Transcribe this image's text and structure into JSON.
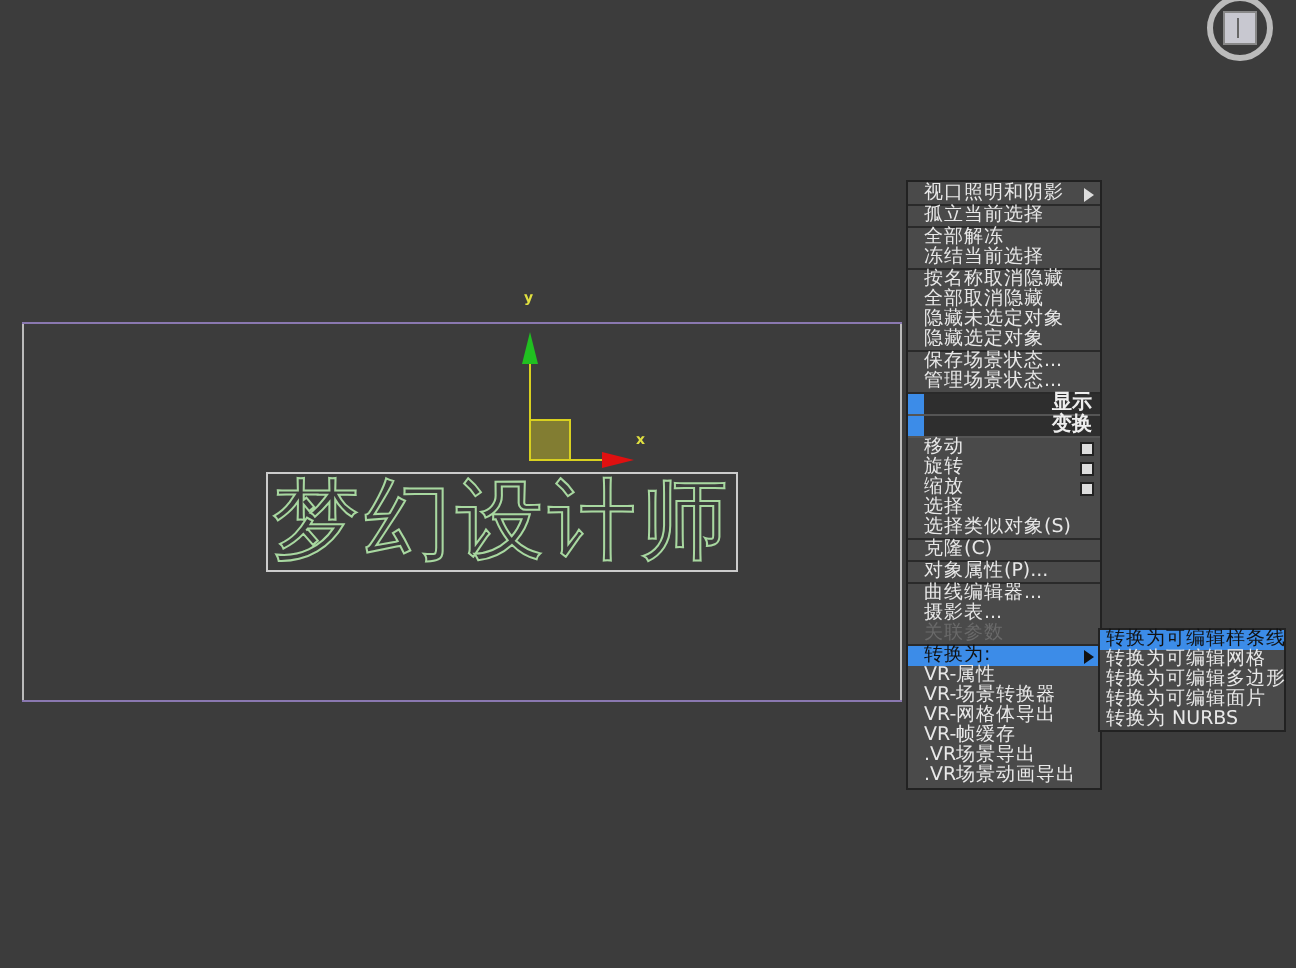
{
  "viewport": {
    "object_text": "梦幻设计师",
    "axis_y": "y",
    "axis_x": "x"
  },
  "menu": {
    "items": [
      {
        "kind": "submenu",
        "label": "视口照明和阴影",
        "selected": false,
        "disabled": false
      },
      {
        "kind": "separator"
      },
      {
        "kind": "item",
        "label": "孤立当前选择",
        "selected": false,
        "disabled": false
      },
      {
        "kind": "separator"
      },
      {
        "kind": "item",
        "label": "全部解冻",
        "selected": false,
        "disabled": false
      },
      {
        "kind": "item",
        "label": "冻结当前选择",
        "selected": false,
        "disabled": false
      },
      {
        "kind": "separator"
      },
      {
        "kind": "item",
        "label": "按名称取消隐藏",
        "selected": false,
        "disabled": false
      },
      {
        "kind": "item",
        "label": "全部取消隐藏",
        "selected": false,
        "disabled": false
      },
      {
        "kind": "item",
        "label": "隐藏未选定对象",
        "selected": false,
        "disabled": false
      },
      {
        "kind": "item",
        "label": "隐藏选定对象",
        "selected": false,
        "disabled": false
      },
      {
        "kind": "separator"
      },
      {
        "kind": "item",
        "label": "保存场景状态...",
        "selected": false,
        "disabled": false
      },
      {
        "kind": "item",
        "label": "管理场景状态...",
        "selected": false,
        "disabled": false
      },
      {
        "kind": "separator"
      },
      {
        "kind": "header",
        "label": "显示"
      },
      {
        "kind": "header",
        "label": "变换"
      },
      {
        "kind": "option",
        "label": "移动",
        "selected": false,
        "disabled": false
      },
      {
        "kind": "option",
        "label": "旋转",
        "selected": false,
        "disabled": false
      },
      {
        "kind": "option",
        "label": "缩放",
        "selected": false,
        "disabled": false
      },
      {
        "kind": "item",
        "label": "选择",
        "selected": false,
        "disabled": false
      },
      {
        "kind": "item",
        "label": "选择类似对象(S)",
        "selected": false,
        "disabled": false
      },
      {
        "kind": "separator"
      },
      {
        "kind": "item",
        "label": "克隆(C)",
        "selected": false,
        "disabled": false
      },
      {
        "kind": "separator"
      },
      {
        "kind": "item",
        "label": "对象属性(P)...",
        "selected": false,
        "disabled": false
      },
      {
        "kind": "separator"
      },
      {
        "kind": "item",
        "label": "曲线编辑器...",
        "selected": false,
        "disabled": false
      },
      {
        "kind": "item",
        "label": "摄影表...",
        "selected": false,
        "disabled": false
      },
      {
        "kind": "item",
        "label": "关联参数",
        "selected": false,
        "disabled": true
      },
      {
        "kind": "separator"
      },
      {
        "kind": "submenu",
        "label": "转换为:",
        "selected": true,
        "disabled": false
      },
      {
        "kind": "item",
        "label": "VR-属性",
        "selected": false,
        "disabled": false
      },
      {
        "kind": "item",
        "label": "VR-场景转换器",
        "selected": false,
        "disabled": false
      },
      {
        "kind": "item",
        "label": "VR-网格体导出",
        "selected": false,
        "disabled": false
      },
      {
        "kind": "item",
        "label": "VR-帧缓存",
        "selected": false,
        "disabled": false
      },
      {
        "kind": "item",
        "label": ".VR场景导出",
        "selected": false,
        "disabled": false
      },
      {
        "kind": "item",
        "label": ".VR场景动画导出",
        "selected": false,
        "disabled": false
      }
    ]
  },
  "submenu": [
    {
      "label": "转换为可编辑样条线",
      "selected": true
    },
    {
      "label": "转换为可编辑网格",
      "selected": false
    },
    {
      "label": "转换为可编辑多边形",
      "selected": false
    },
    {
      "label": "转换为可编辑面片",
      "selected": false
    },
    {
      "label": "转换为 NURBS",
      "selected": false
    }
  ]
}
